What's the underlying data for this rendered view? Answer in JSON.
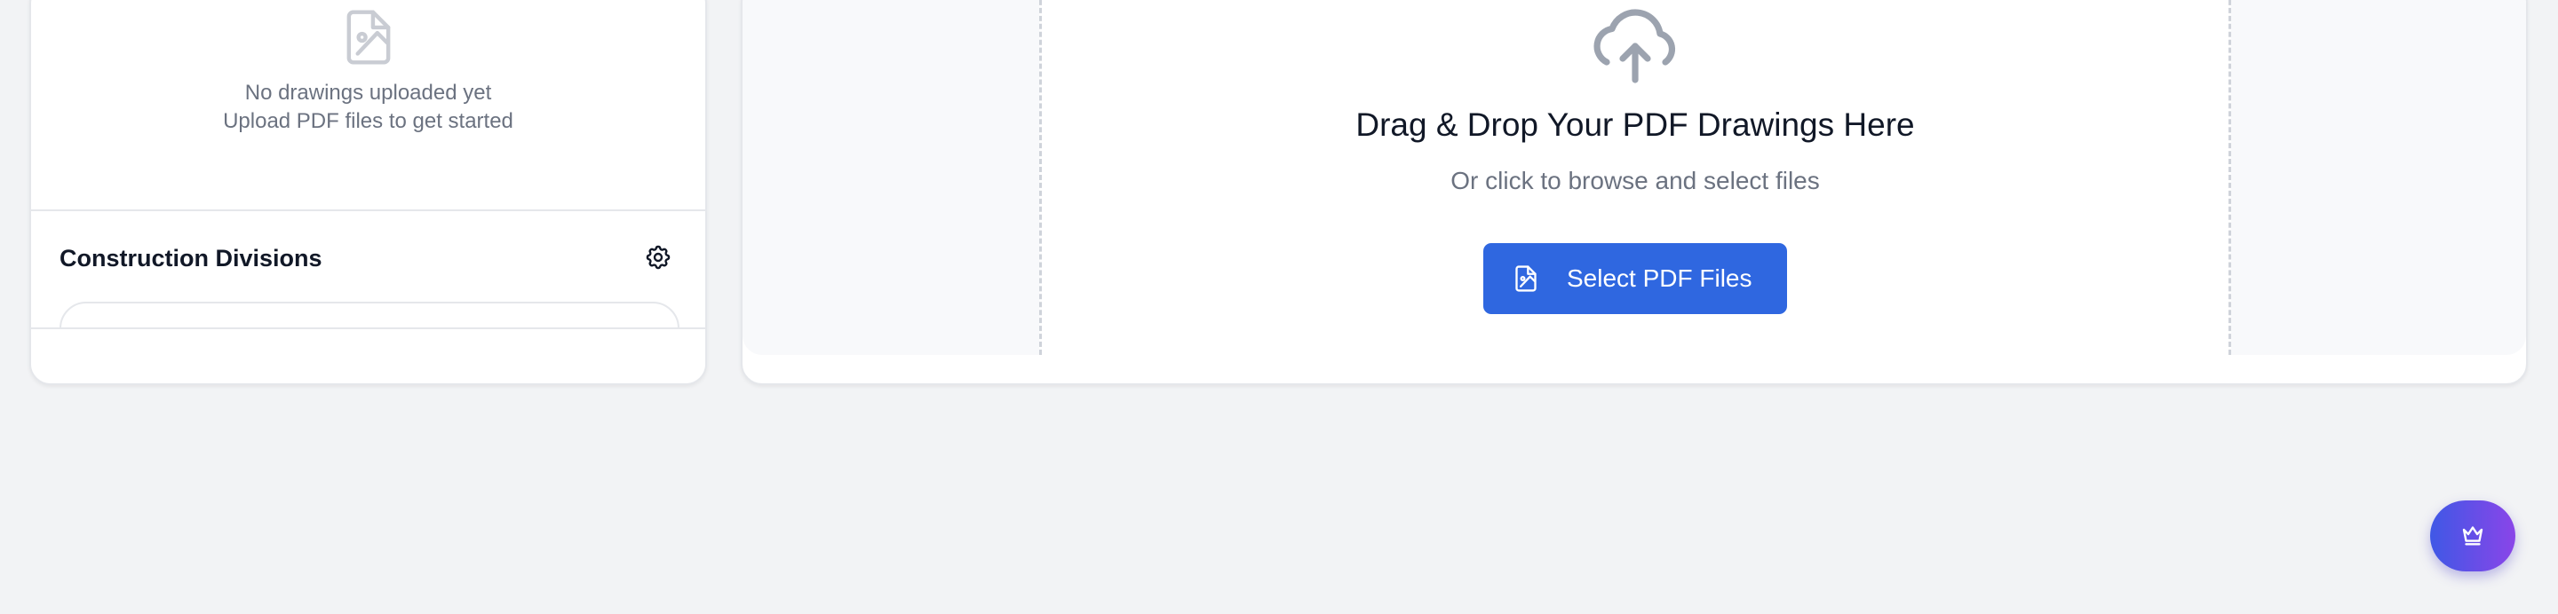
{
  "sidebar": {
    "empty_state": {
      "icon": "image-file-icon",
      "line1": "No drawings uploaded yet",
      "line2": "Upload PDF files to get started"
    },
    "divisions": {
      "title": "Construction Divisions",
      "settings_icon": "gear-icon"
    }
  },
  "upload": {
    "icon": "cloud-upload-icon",
    "title": "Drag & Drop Your PDF Drawings Here",
    "subtitle": "Or click to browse and select files",
    "button_label": "Select PDF Files",
    "button_icon": "image-file-icon"
  },
  "fab": {
    "icon": "crown-icon"
  },
  "colors": {
    "background": "#f2f3f5",
    "primary_button": "#2f67e0",
    "fab_gradient_start": "#3f58e6",
    "fab_gradient_end": "#8a45e8",
    "muted_text": "#6b7280",
    "icon_gray": "#9ca3af"
  }
}
